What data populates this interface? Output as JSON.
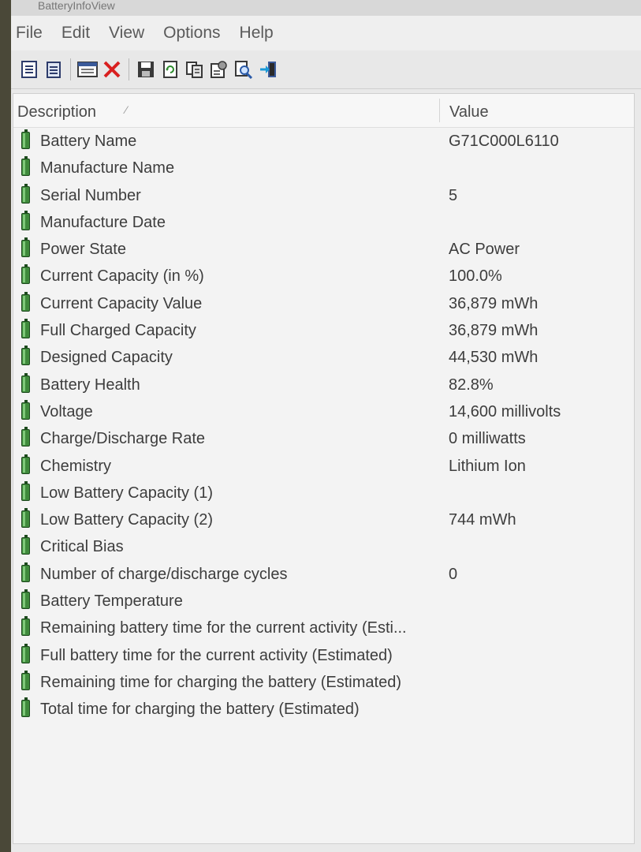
{
  "window": {
    "title": "BatteryInfoView"
  },
  "menu": [
    "File",
    "Edit",
    "View",
    "Options",
    "Help"
  ],
  "toolbar": {
    "icons": [
      "properties-icon",
      "copy-icon",
      "html-report-icon",
      "delete-icon",
      "save-icon",
      "refresh-icon",
      "copy-text-icon",
      "options-icon",
      "find-icon",
      "exit-icon"
    ]
  },
  "list": {
    "columns": {
      "description": "Description",
      "value": "Value"
    },
    "rows": [
      {
        "description": "Battery Name",
        "value": "G71C000L6110"
      },
      {
        "description": "Manufacture Name",
        "value": ""
      },
      {
        "description": "Serial Number",
        "value": "5"
      },
      {
        "description": "Manufacture Date",
        "value": ""
      },
      {
        "description": "Power State",
        "value": "AC Power"
      },
      {
        "description": "Current Capacity (in %)",
        "value": "100.0%"
      },
      {
        "description": "Current Capacity Value",
        "value": "36,879 mWh"
      },
      {
        "description": "Full Charged Capacity",
        "value": "36,879 mWh"
      },
      {
        "description": "Designed Capacity",
        "value": "44,530 mWh"
      },
      {
        "description": "Battery Health",
        "value": "82.8%"
      },
      {
        "description": "Voltage",
        "value": "14,600 millivolts"
      },
      {
        "description": "Charge/Discharge Rate",
        "value": "0 milliwatts"
      },
      {
        "description": "Chemistry",
        "value": "Lithium Ion"
      },
      {
        "description": "Low Battery Capacity (1)",
        "value": ""
      },
      {
        "description": "Low Battery Capacity (2)",
        "value": "744 mWh"
      },
      {
        "description": "Critical Bias",
        "value": ""
      },
      {
        "description": "Number of charge/discharge cycles",
        "value": "0"
      },
      {
        "description": "Battery Temperature",
        "value": ""
      },
      {
        "description": "Remaining battery time for the current activity (Esti...",
        "value": ""
      },
      {
        "description": "Full battery time for the current activity (Estimated)",
        "value": ""
      },
      {
        "description": "Remaining time for charging the battery (Estimated)",
        "value": ""
      },
      {
        "description": "Total  time for charging the battery (Estimated)",
        "value": ""
      }
    ]
  }
}
